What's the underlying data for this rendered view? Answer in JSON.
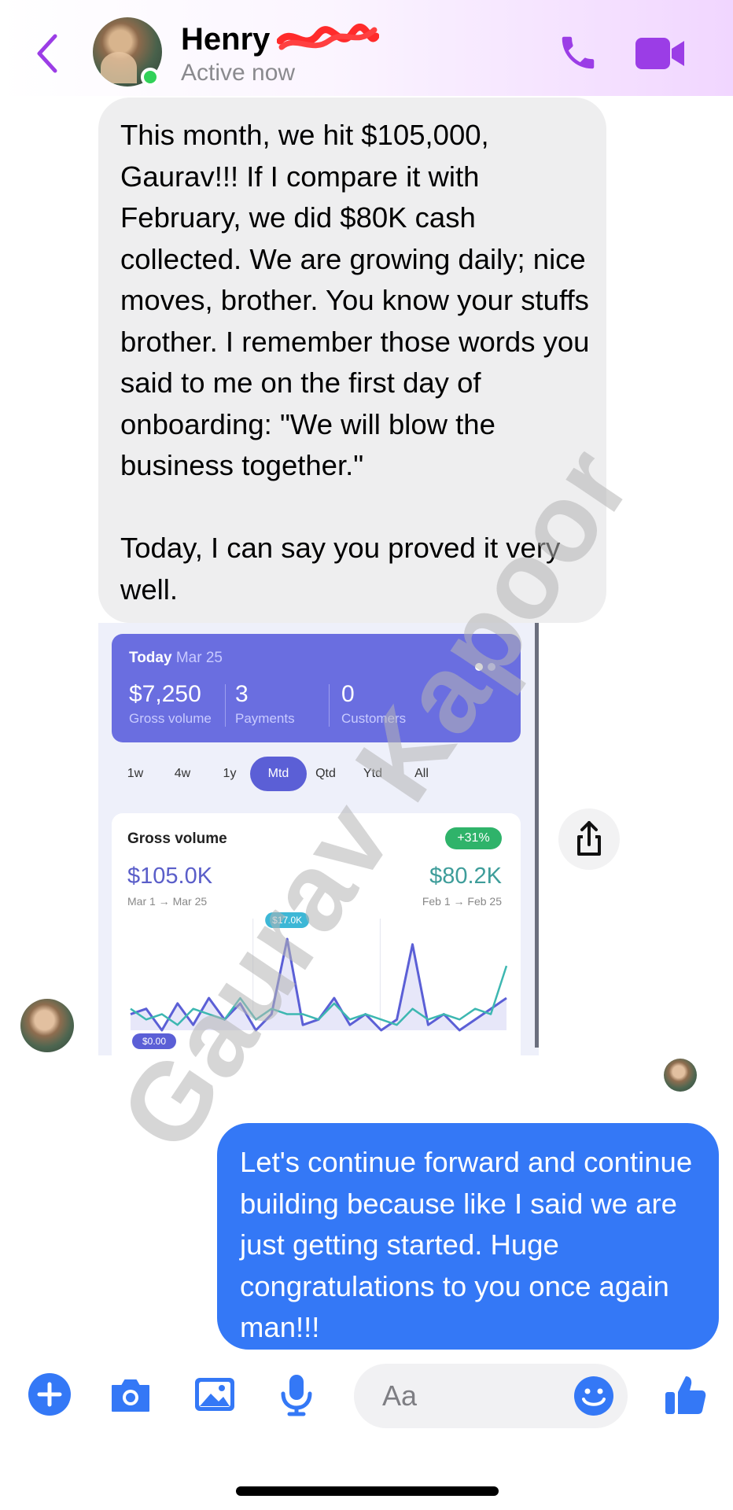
{
  "header": {
    "contact_name": "Henry",
    "status": "Active now",
    "colors": {
      "accent": "#9b3de6",
      "online": "#31d158"
    },
    "icons": [
      "back-chevron-icon",
      "phone-icon",
      "video-camera-icon"
    ]
  },
  "incoming_message": {
    "text": "This month, we hit $105,000, Gaurav!!! If I compare it with February, we did $80K cash collected. We are growing daily; nice moves, brother. You know your stuffs brother. I remember those words you said to me on the first day of onboarding: \"We will blow the business together.\"\n\nToday, I can say you proved it very well."
  },
  "shared_screenshot": {
    "today": {
      "label": "Today",
      "date": "Mar 25"
    },
    "stats": [
      {
        "value": "$7,250",
        "label": "Gross volume"
      },
      {
        "value": "3",
        "label": "Payments"
      },
      {
        "value": "0",
        "label": "Customers"
      }
    ],
    "ranges": [
      "1w",
      "4w",
      "1y",
      "Mtd",
      "Qtd",
      "Ytd",
      "All"
    ],
    "selected_range": "Mtd",
    "gross": {
      "title": "Gross volume",
      "badge": "+31%",
      "current_value": "$105.0K",
      "current_range": "Mar 1 → Mar 25",
      "previous_value": "$80.2K",
      "previous_range": "Feb 1 → Feb 25",
      "peak_label": "$17.0K",
      "min_label": "$0.00"
    },
    "chart_data": {
      "type": "line",
      "x": [
        1,
        2,
        3,
        4,
        5,
        6,
        7,
        8,
        9,
        10,
        11,
        12,
        13,
        14,
        15,
        16,
        17,
        18,
        19,
        20,
        21,
        22,
        23,
        24,
        25
      ],
      "series": [
        {
          "values": [
            3,
            4,
            0,
            5,
            1,
            6,
            2,
            5,
            0,
            3,
            17,
            1,
            2,
            6,
            1,
            3,
            0,
            2,
            16,
            1,
            3,
            0,
            2,
            4,
            6
          ]
        },
        {
          "values": [
            4,
            2,
            3,
            1,
            4,
            3,
            2,
            6,
            2,
            4,
            3,
            3,
            2,
            5,
            2,
            3,
            2,
            1,
            4,
            2,
            3,
            2,
            4,
            3,
            12
          ]
        }
      ],
      "colors": [
        "#5b5fd6",
        "#3db7b1"
      ]
    }
  },
  "outgoing_message": {
    "text": "Let's continue forward and continue building because like I said we are just getting started. Huge congratulations to you once again man!!!"
  },
  "watermark": "Gaurav Kapoor",
  "composer": {
    "placeholder": "Aa",
    "icons": [
      "plus-icon",
      "camera-icon",
      "image-icon",
      "microphone-icon",
      "emoji-icon",
      "thumbs-up-icon"
    ]
  }
}
